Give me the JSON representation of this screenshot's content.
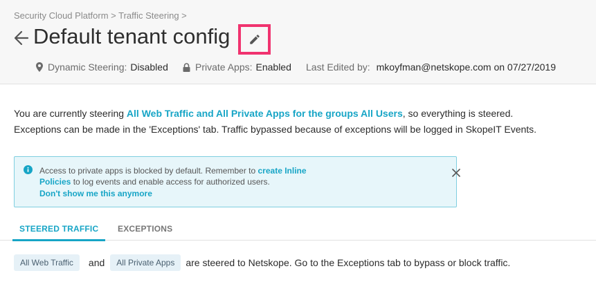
{
  "breadcrumb": "Security Cloud Platform > Traffic Steering >",
  "title": "Default tenant config",
  "meta": {
    "dynamic_label": "Dynamic Steering:",
    "dynamic_value": "Disabled",
    "private_label": "Private Apps:",
    "private_value": "Enabled",
    "edited_label": "Last Edited by:",
    "edited_value": "mkoyfman@netskope.com on 07/27/2019"
  },
  "intro": {
    "line1_pre": "You are currently steering ",
    "line1_hl": "All Web Traffic and All Private Apps for the groups All Users",
    "line1_post": ", so everything is steered.",
    "line2": "Exceptions can be made in the 'Exceptions' tab. Traffic bypassed because of exceptions will be logged in SkopeIT Events."
  },
  "alert": {
    "text_pre": "Access to private apps is blocked by default. Remember to ",
    "link": "create Inline Policies",
    "text_post": " to log events and enable access for authorized users.",
    "dismiss": "Don't show me this anymore"
  },
  "tabs": {
    "steered": "STEERED TRAFFIC",
    "exceptions": "EXCEPTIONS"
  },
  "summary": {
    "chip1": "All Web Traffic",
    "and": "and",
    "chip2": "All Private Apps",
    "text": "are steered to Netskope. Go to the Exceptions tab to bypass or block traffic."
  },
  "colors": {
    "accent": "#17a5c6",
    "highlight_border": "#f0336f",
    "alert_bg": "#e7f6fa"
  },
  "icons": [
    "back-arrow-icon",
    "pencil-icon",
    "location-pin-icon",
    "lock-icon",
    "info-icon",
    "close-icon"
  ]
}
